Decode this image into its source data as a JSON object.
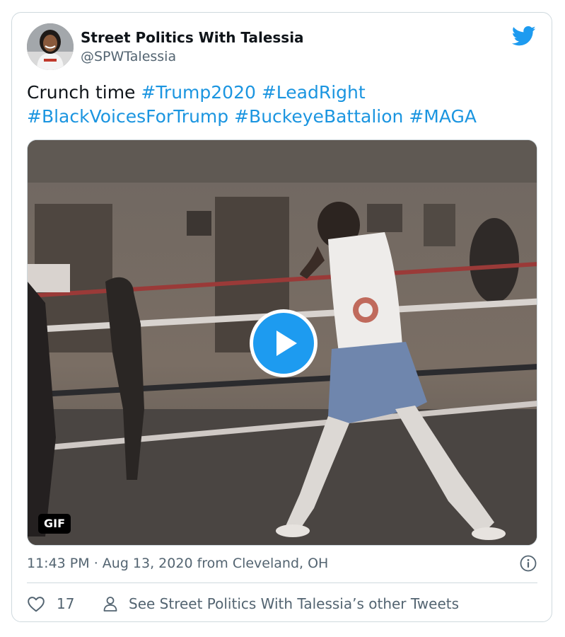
{
  "author": {
    "display_name": "Street Politics With Talessia",
    "handle": "@SPWTalessia"
  },
  "tweet": {
    "lead_text": "Crunch time ",
    "hashtags": [
      "#Trump2020",
      "#LeadRight",
      "#BlackVoicesForTrump",
      "#BuckeyeBattalion",
      "#MAGA"
    ]
  },
  "media": {
    "badge": "GIF"
  },
  "meta": {
    "time": "11:43 PM",
    "separator": " · ",
    "date": "Aug 13, 2020",
    "location": " from Cleveland, OH"
  },
  "actions": {
    "like_count": "17",
    "other_tweets_label": "See Street Politics With Talessia’s other Tweets"
  },
  "icons": {
    "brand": "twitter-bird-icon",
    "play": "play-icon",
    "info": "info-icon",
    "like": "heart-icon",
    "profile": "person-icon"
  },
  "colors": {
    "accent": "#1d9bf0",
    "hashtag": "#1b95e0",
    "muted": "#536471",
    "border": "#cfd9de"
  }
}
